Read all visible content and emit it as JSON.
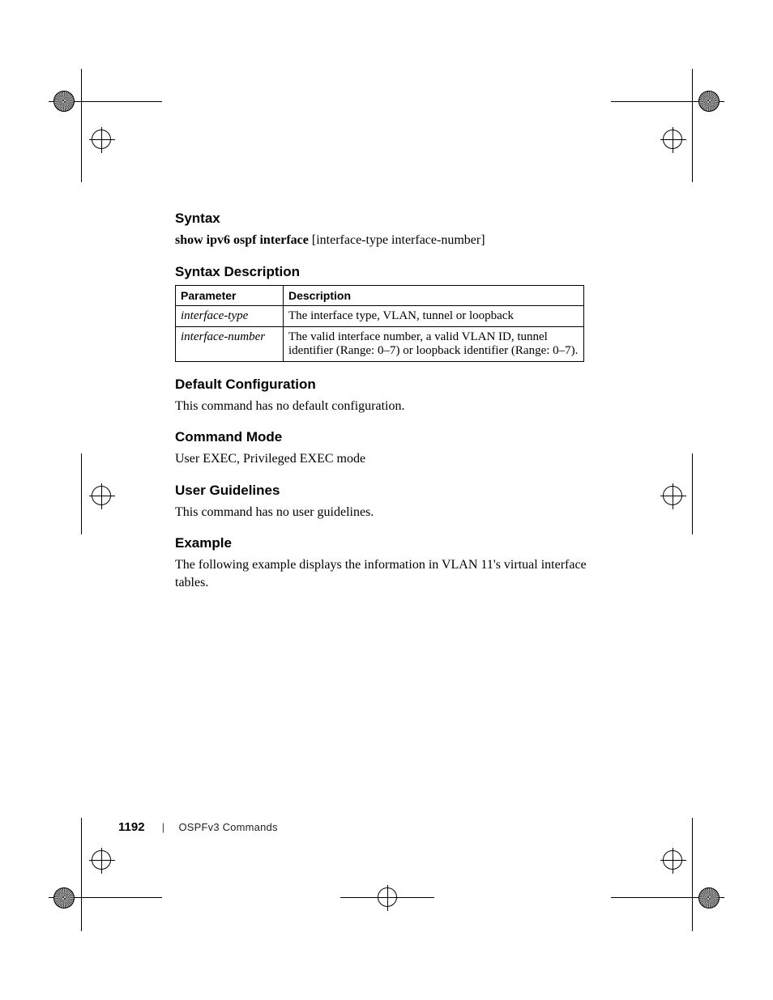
{
  "sections": {
    "syntax": {
      "heading": "Syntax",
      "command_bold": "show ipv6 ospf interface",
      "command_rest": " [interface-type interface-number]"
    },
    "syntax_description": {
      "heading": "Syntax Description",
      "table": {
        "headers": [
          "Parameter",
          "Description"
        ],
        "rows": [
          {
            "param": "interface-type",
            "desc": "The interface type, VLAN, tunnel or loopback"
          },
          {
            "param": "interface-number",
            "desc": "The valid interface number, a valid VLAN ID, tunnel identifier (Range: 0–7) or loopback identifier (Range: 0–7)."
          }
        ]
      }
    },
    "default_configuration": {
      "heading": "Default Configuration",
      "body": "This command has no default configuration."
    },
    "command_mode": {
      "heading": "Command Mode",
      "body": "User EXEC, Privileged EXEC mode"
    },
    "user_guidelines": {
      "heading": "User Guidelines",
      "body": "This command has no user guidelines."
    },
    "example": {
      "heading": "Example",
      "body": "The following example displays the information in VLAN 11's virtual interface tables."
    }
  },
  "footer": {
    "page_number": "1192",
    "separator": "|",
    "section_title": "OSPFv3 Commands"
  }
}
